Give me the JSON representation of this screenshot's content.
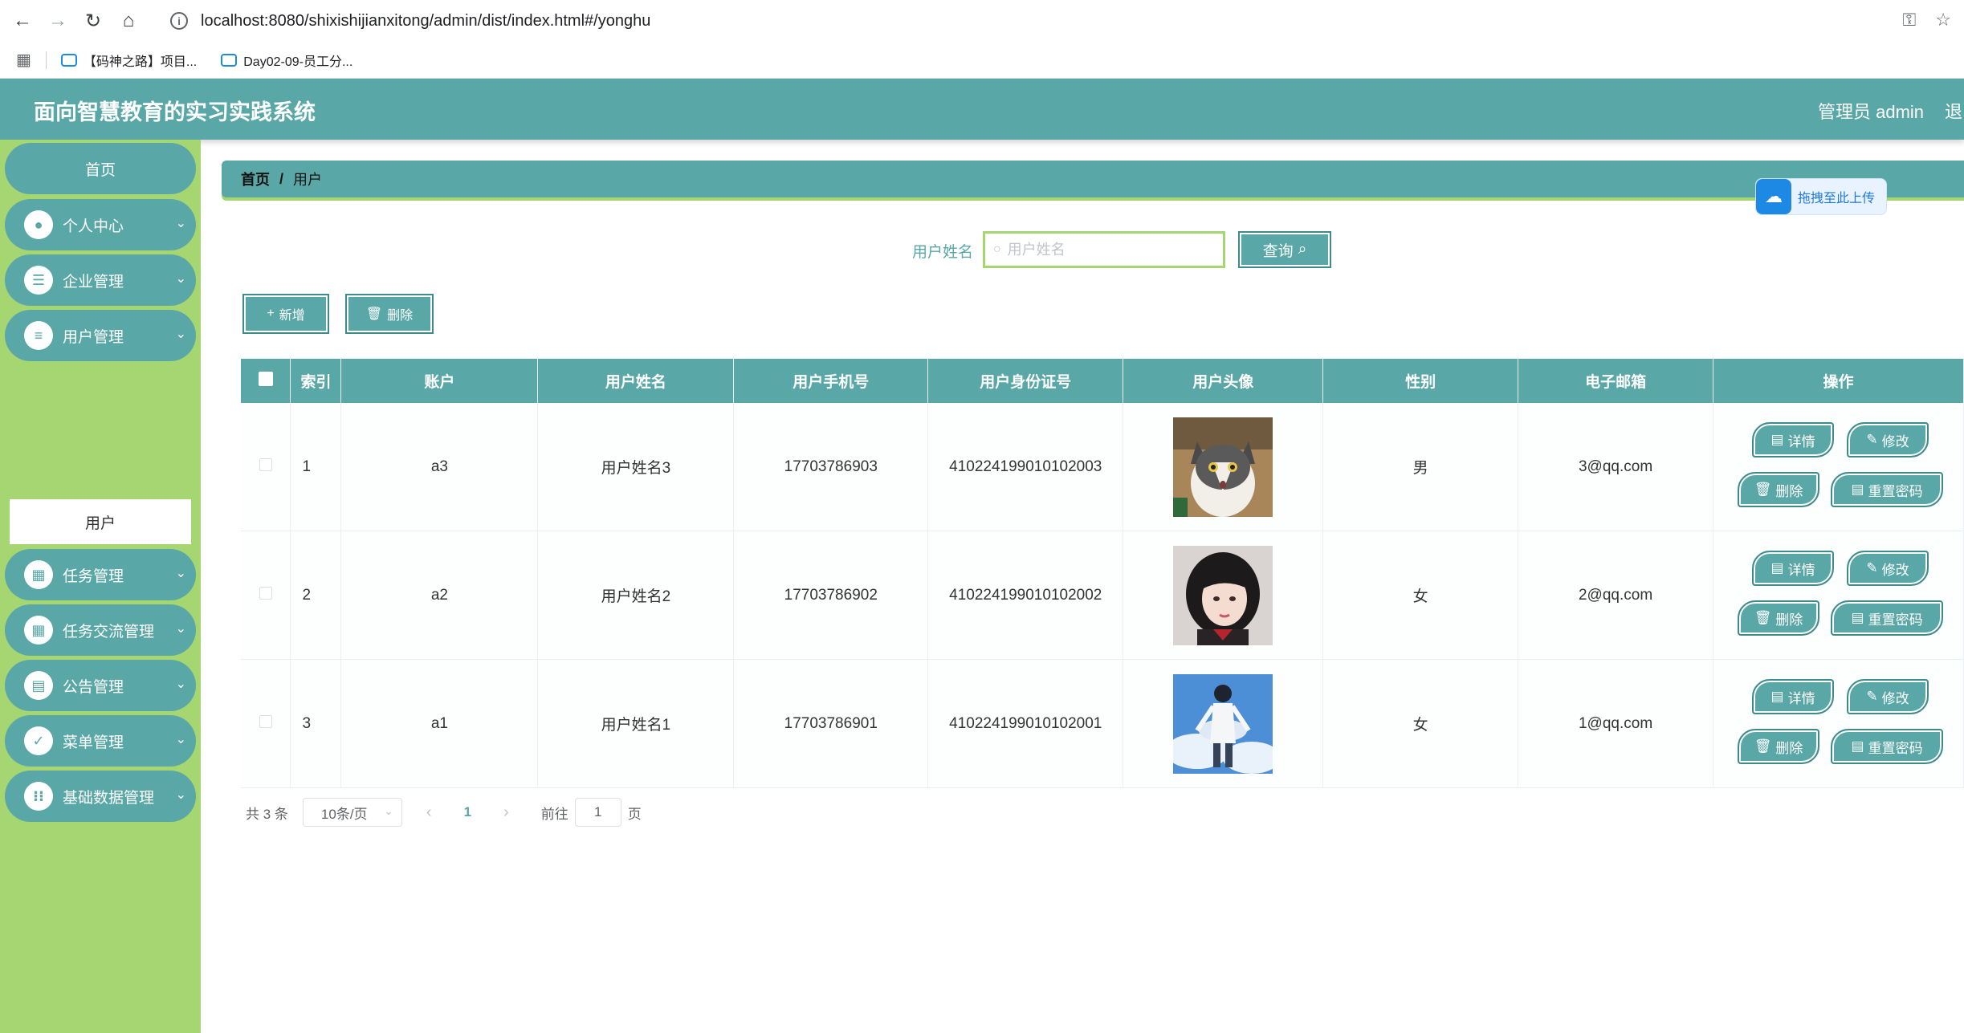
{
  "browser": {
    "url": "localhost:8080/shixishijianxitong/admin/dist/index.html#/yonghu",
    "bookmarks": [
      {
        "label": "【码神之路】项目..."
      },
      {
        "label": "Day02-09-员工分..."
      }
    ]
  },
  "header": {
    "title": "面向智慧教育的实习实践系统",
    "user": "管理员 admin",
    "logout": "退出登录"
  },
  "sidebar": {
    "home": "首页",
    "items": [
      {
        "label": "个人中心",
        "icon": "user-icon"
      },
      {
        "label": "企业管理",
        "icon": "sliders-icon"
      },
      {
        "label": "用户管理",
        "icon": "list-icon"
      },
      {
        "label": "任务管理",
        "icon": "grid-icon"
      },
      {
        "label": "任务交流管理",
        "icon": "grid-icon"
      },
      {
        "label": "公告管理",
        "icon": "chart-icon"
      },
      {
        "label": "菜单管理",
        "icon": "clipboard-icon"
      },
      {
        "label": "基础数据管理",
        "icon": "apps-icon"
      }
    ],
    "active_sub": "用户"
  },
  "breadcrumb": {
    "home": "首页",
    "current": "用户"
  },
  "upload_badge": "拖拽至此上传",
  "search": {
    "label": "用户姓名",
    "placeholder": "用户姓名",
    "button": "查询"
  },
  "actions": {
    "add": "新增",
    "delete": "删除"
  },
  "table": {
    "columns": [
      "索引",
      "账户",
      "用户姓名",
      "用户手机号",
      "用户身份证号",
      "用户头像",
      "性别",
      "电子邮箱",
      "操作"
    ],
    "rows": [
      {
        "index": "1",
        "account": "a3",
        "name": "用户姓名3",
        "phone": "17703786903",
        "id_card": "410224199010102003",
        "gender": "男",
        "email": "3@qq.com"
      },
      {
        "index": "2",
        "account": "a2",
        "name": "用户姓名2",
        "phone": "17703786902",
        "id_card": "410224199010102002",
        "gender": "女",
        "email": "2@qq.com"
      },
      {
        "index": "3",
        "account": "a1",
        "name": "用户姓名1",
        "phone": "17703786901",
        "id_card": "410224199010102001",
        "gender": "女",
        "email": "1@qq.com"
      }
    ],
    "ops": {
      "detail": "详情",
      "edit": "修改",
      "delete": "删除",
      "reset": "重置密码"
    }
  },
  "pager": {
    "total": "共 3 条",
    "size": "10条/页",
    "page": "1",
    "goto": "前往",
    "goto_value": "1",
    "page_unit": "页"
  },
  "colors": {
    "primary": "#5aa7a7",
    "sidebar": "#a5d672"
  }
}
